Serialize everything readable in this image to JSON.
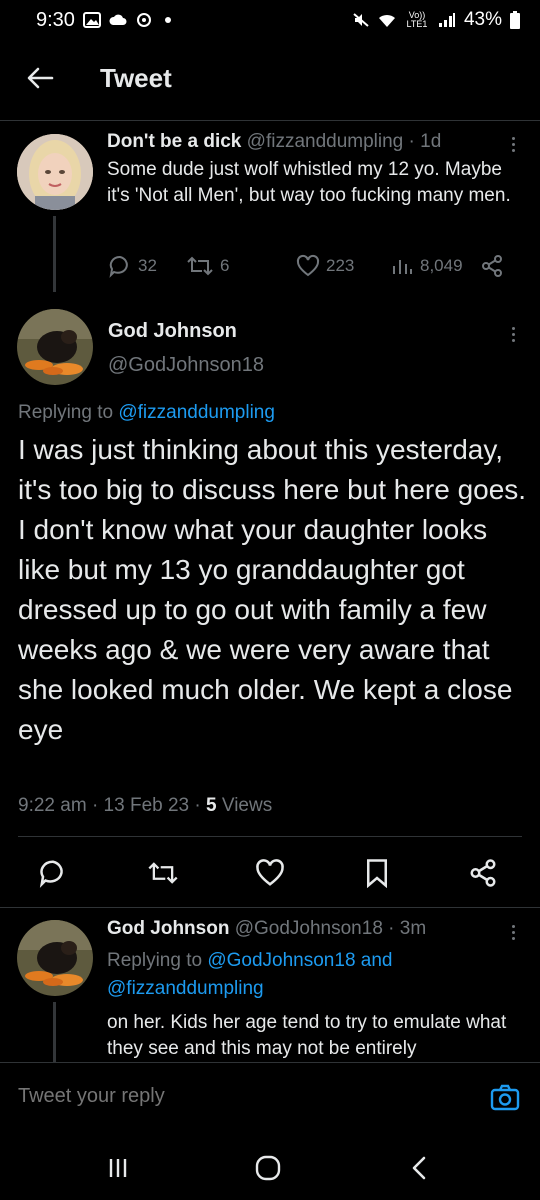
{
  "status_bar": {
    "time": "9:30",
    "battery": "43%",
    "network": "Vo)) LTE1"
  },
  "header": {
    "title": "Tweet"
  },
  "parent_tweet": {
    "display_name": "Don't be a dick",
    "handle": "@fizzanddumpling",
    "age": "· 1d",
    "text": "Some dude just wolf whistled my 12 yo. Maybe it's 'Not all Men', but way too fucking many men.",
    "replies": "32",
    "retweets": "6",
    "likes": "223",
    "views": "8,049"
  },
  "main_tweet": {
    "display_name": "God Johnson",
    "handle": "@GodJohnson18",
    "replying_prefix": "Replying to",
    "replying_to": "@fizzanddumpling",
    "text": "I was just thinking about this yesterday, it's too big to discuss here but here goes. I don't know what your daughter looks like but my 13 yo granddaughter got dressed up to go out with family a few weeks ago & we were very aware that she looked much older. We kept a close eye",
    "time": "9:22 am",
    "date": "13 Feb 23",
    "views_count": "5",
    "views_label": "Views"
  },
  "reply_tweet": {
    "display_name": "God Johnson",
    "handle": "@GodJohnson18",
    "age": "· 3m",
    "replying_prefix": "Replying to",
    "replying_to_1": "@GodJohnson18",
    "and": "and",
    "replying_to_2": "@fizzanddumpling",
    "text": "on her. Kids her age tend to try to emulate what they see and this may not be entirely"
  },
  "composer": {
    "placeholder": "Tweet your reply"
  },
  "icons": {
    "back": "arrow-left-icon",
    "reply": "comment-icon",
    "retweet": "retweet-icon",
    "like": "heart-icon",
    "views": "bar-chart-icon",
    "share": "share-icon",
    "bookmark": "bookmark-icon",
    "camera": "camera-icon",
    "more": "more-vertical-icon"
  },
  "colors": {
    "background": "#000000",
    "text": "#e7e9ea",
    "muted": "#71767b",
    "accent": "#1d9bf0",
    "divider": "#2f3336"
  }
}
